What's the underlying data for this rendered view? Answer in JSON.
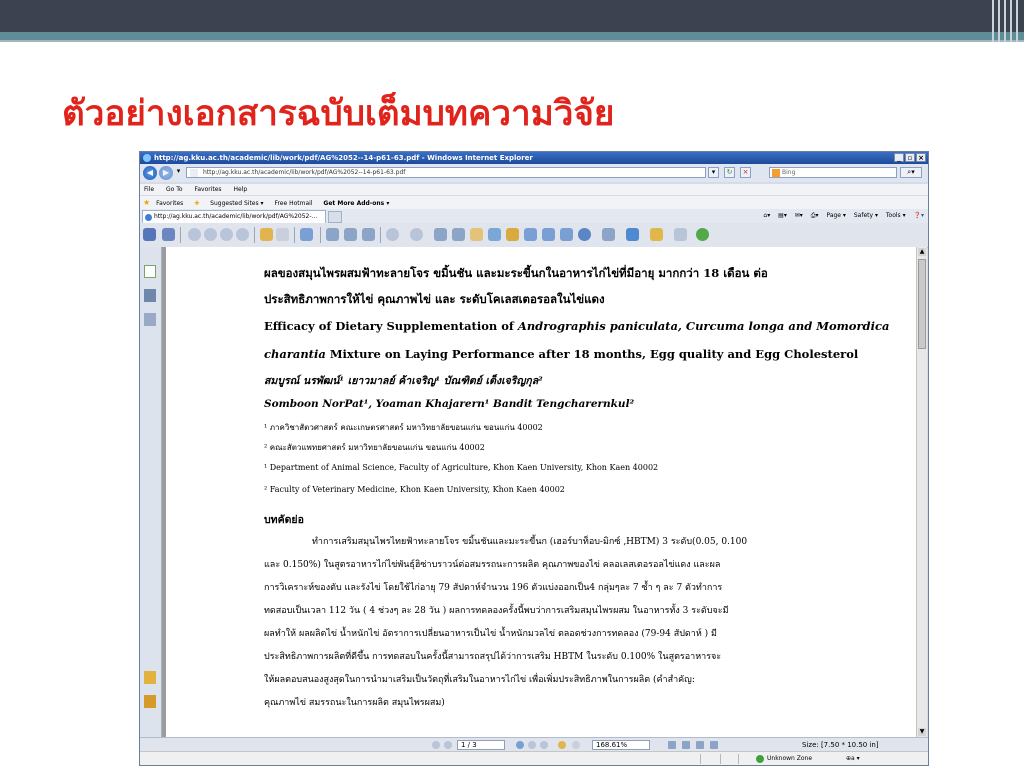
{
  "slide": {
    "title": "ตัวอย่างเอกสารฉบับเต็มบทความวิจัย"
  },
  "browser": {
    "window_title": "http://ag.kku.ac.th/academic/lib/work/pdf/AG%2052--14-p61-63.pdf - Windows Internet Explorer",
    "address": "http://ag.kku.ac.th/academic/lib/work/pdf/AG%2052--14-p61-63.pdf",
    "search_placeholder": "Bing",
    "menu": [
      "File",
      "Go To",
      "Favorites",
      "Help"
    ],
    "favorites_label": "Favorites",
    "favorites_links": [
      "Suggested Sites ▾",
      "Free Hotmail",
      "Get More Add-ons ▾"
    ],
    "tab_title": "http://ag.kku.ac.th/academic/lib/work/pdf/AG%2052-...",
    "command_bar": [
      "Page ▾",
      "Safety ▾",
      "Tools ▾"
    ],
    "status_zone": "Unknown Zone"
  },
  "pdf": {
    "page_indicator": "1 / 3",
    "zoom": "168.61%",
    "page_size": "Size: [7.50 * 10.50 in]",
    "thai_title_1": "ผลของสมุนไพรผสมฟ้าทะลายโจร ขมิ้นชัน และมะระขี้นกในอาหารไก่ไข่ที่มีอายุ มากกว่า 18 เดือน ต่อ",
    "thai_title_2": "ประสิทธิภาพการให้ไข่ คุณภาพไข่ และ ระดับโคเลสเตอรอลในไข่แดง",
    "en_title_1a": "Efficacy of Dietary Supplementation of ",
    "en_title_1b": "Andrographis paniculata, Curcuma longa and Momordica",
    "en_title_2a": "charantia",
    "en_title_2b": " Mixture on Laying Performance after 18 months, Egg quality and Egg Cholesterol",
    "thai_authors": "สมบูรณ์ นรพัฒน์¹ เยาวมาลย์ ค้าเจริญ¹ บัณฑิตย์ เต็งเจริญกุล²",
    "en_authors": "Somboon NorPat¹, Yoaman Khajarern¹ Bandit Tengcharernkul²",
    "aff_1": "¹ ภาควิชาสัตวศาสตร์ คณะเกษตรศาสตร์ มหาวิทยาลัยขอนแก่น ขอนแก่น 40002",
    "aff_2": "² คณะสัตวแพทยศาสตร์ มหาวิทยาลัยขอนแก่น ขอนแก่น 40002",
    "aff_3": "¹ Department of Animal Science, Faculty of Agriculture, Khon Kaen University, Khon Kaen 40002",
    "aff_4": "² Faculty of Veterinary Medicine, Khon Kaen University, Khon Kaen 40002",
    "abstract_heading": "บทคัดย่อ",
    "abstract_lines": [
      "ทำการเสริมสมุนไพรไทยฟ้าทะลายโจร ขมิ้นชันและมะระขี้นก (เฮอร์บาท็อบ-มิกซ์ ,HBTM) 3 ระดับ(0.05, 0.100",
      "และ 0.150%) ในสูตรอาหารไก่ไข่พันธุ์ฮิซ่าบราวน์ต่อสมรรถนะการผลิต คุณภาพของไข่ คลอเลสเตอรอลไข่แดง และผล",
      "การวิเคราะห์ของตับ และรังไข่ โดยใช้ไก่อายุ 79 สัปดาห์จำนวน 196 ตัวแบ่งออกเป็น4 กลุ่มๆละ 7 ซ้ำ ๆ ละ 7 ตัวทำการ",
      "ทดสอบเป็นเวลา 112 วัน ( 4 ช่วงๆ ละ 28 วัน ) ผลการทดลองครั้งนี้พบว่าการเสริมสมุนไพรผสม ในอาหารทั้ง 3 ระดับจะมี",
      "ผลทำให้ ผลผลิตไข่ น้ำหนักไข่ อัตราการเปลี่ยนอาหารเป็นไข่ น้ำหนักมวลไข่ ตลอดช่วงการทดลอง (79-94 สัปดาห์ ) มี",
      "ประสิทธิภาพการผลิตที่ดีขึ้น การทดสอบในครั้งนี้สามารถสรุปได้ว่าการเสริม HBTM ในระดับ 0.100% ในสูตรอาหารจะ",
      "ให้ผลตอบสนองสูงสุดในการนำมาเสริมเป็นวัตถุที่เสริมในอาหารไก่ไข่ เพื่อเพิ่มประสิทธิภาพในการผลิต  (คำสำคัญ:",
      "คุณภาพไข่ สมรรถนะในการผลิต สมุนไพรผสม)"
    ]
  },
  "colors": {
    "title_red": "#e0241c",
    "band_dark": "#3c4250",
    "band_teal": "#5f8c96"
  }
}
